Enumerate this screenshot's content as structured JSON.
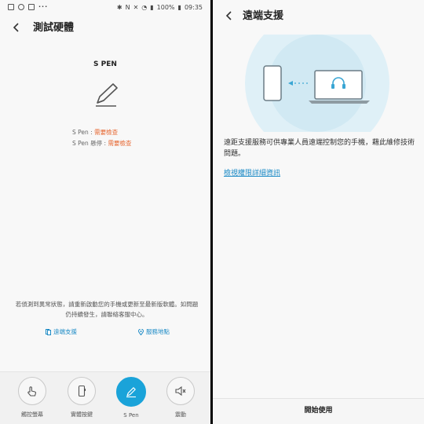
{
  "left": {
    "statusbar": {
      "battery": "100%",
      "time": "09:35"
    },
    "header": {
      "title": "測試硬體"
    },
    "spen": {
      "heading": "S PEN",
      "items": [
        {
          "label": "S Pen : ",
          "status": "需要檢查"
        },
        {
          "label": "S Pen 懸停 : ",
          "status": "需要檢查"
        }
      ],
      "status_color": "#e6642d"
    },
    "notice": "若偵測到異常狀態，請重新啟動您的手機或更新至最新版軟體。如問題仍持續發生，請聯絡客服中心。",
    "links": {
      "remote": "遠端支援",
      "service": "服務地點"
    },
    "tabs": [
      {
        "label": "觸控螢幕",
        "icon": "touch-icon"
      },
      {
        "label": "實體按鍵",
        "icon": "phone-key-icon"
      },
      {
        "label": "S Pen",
        "icon": "pen-icon",
        "active": true
      },
      {
        "label": "震動",
        "icon": "vibrate-icon"
      }
    ],
    "accent": "#1aa3d9"
  },
  "right": {
    "header": {
      "title": "遠端支援"
    },
    "description": "遠距支援服務可供專業人員遠端控制您的手機，藉此維修技術問題。",
    "permission_link": "檢視權限詳細資訊",
    "start_button": "開始使用"
  }
}
